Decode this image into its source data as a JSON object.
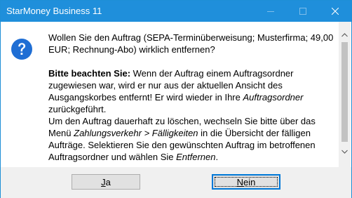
{
  "window": {
    "title": "StarMoney Business 11"
  },
  "titlebar_buttons": {
    "minimize": "minimize-icon",
    "maximize": "maximize-icon",
    "close": "close-icon"
  },
  "icon": "question-icon",
  "message": {
    "question": "Wollen Sie den Auftrag (SEPA-Terminüberweisung; Musterfirma; 49,00 EUR; Rechnung-Abo) wirklich entfernen?",
    "note_label": "Bitte beachten Sie:",
    "note_text_1": " Wenn der Auftrag einem Auftragsordner zugewiesen war, wird er nur aus der aktuellen Ansicht des Ausgangskorbes entfernt! Er wird wieder in Ihre ",
    "note_italic_1": "Auftragsordner",
    "note_text_2": " zurückgeführt.",
    "delete_text_1": "Um den Auftrag dauerhaft zu löschen, wechseln Sie bitte über das Menü ",
    "delete_italic_1": "Zahlungsverkehr > Fälligkeiten",
    "delete_text_2": " in die Übersicht der fälligen Aufträge. Selektieren Sie den gewünschten Auftrag im betroffenen Auftragsordner und wählen Sie ",
    "delete_italic_2": "Entfernen",
    "delete_text_3": "."
  },
  "buttons": {
    "yes_mnemonic": "J",
    "yes_rest": "a",
    "no_mnemonic": "N",
    "no_rest": "ein"
  },
  "colors": {
    "titlebar": "#1f8fdb",
    "icon": "#1f6ed4",
    "default_button_border": "#0078d7"
  }
}
